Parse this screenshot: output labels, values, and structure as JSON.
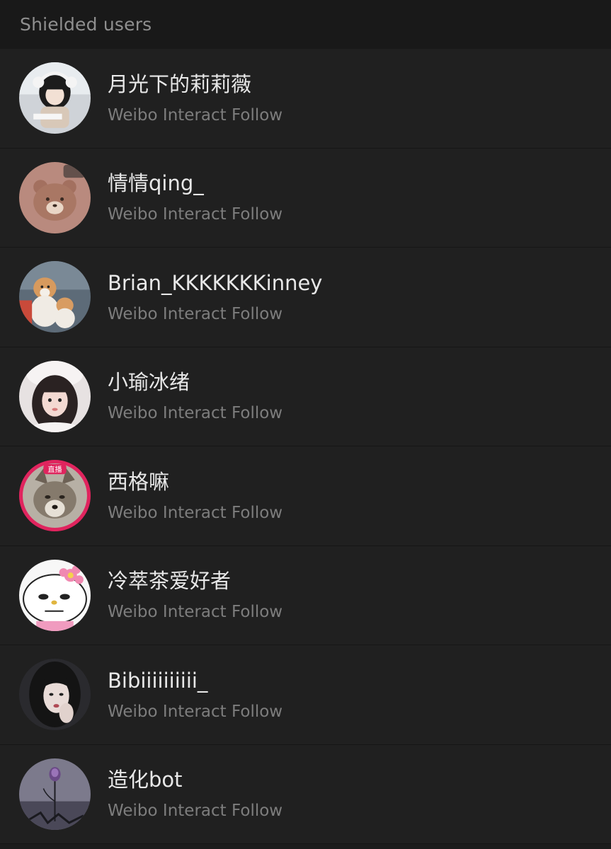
{
  "header": {
    "title": "Shielded users"
  },
  "users": [
    {
      "name": "月光下的莉莉薇",
      "subtitle": "Weibo Interact Follow"
    },
    {
      "name": "情情qing_",
      "subtitle": "Weibo Interact Follow"
    },
    {
      "name": "Brian_KKKKKKKinney",
      "subtitle": "Weibo Interact Follow"
    },
    {
      "name": "小瑜冰绪",
      "subtitle": "Weibo Interact Follow"
    },
    {
      "name": "西格嘛",
      "subtitle": "Weibo Interact Follow",
      "live_badge": "直播"
    },
    {
      "name": "冷萃茶爱好者",
      "subtitle": "Weibo Interact Follow"
    },
    {
      "name": "Bibiiiiiiiiii_",
      "subtitle": "Weibo Interact Follow"
    },
    {
      "name": "造化bot",
      "subtitle": "Weibo Interact Follow"
    }
  ],
  "colors": {
    "live_ring": "#e0245e",
    "background": "#202020",
    "header_bg": "#191919"
  }
}
